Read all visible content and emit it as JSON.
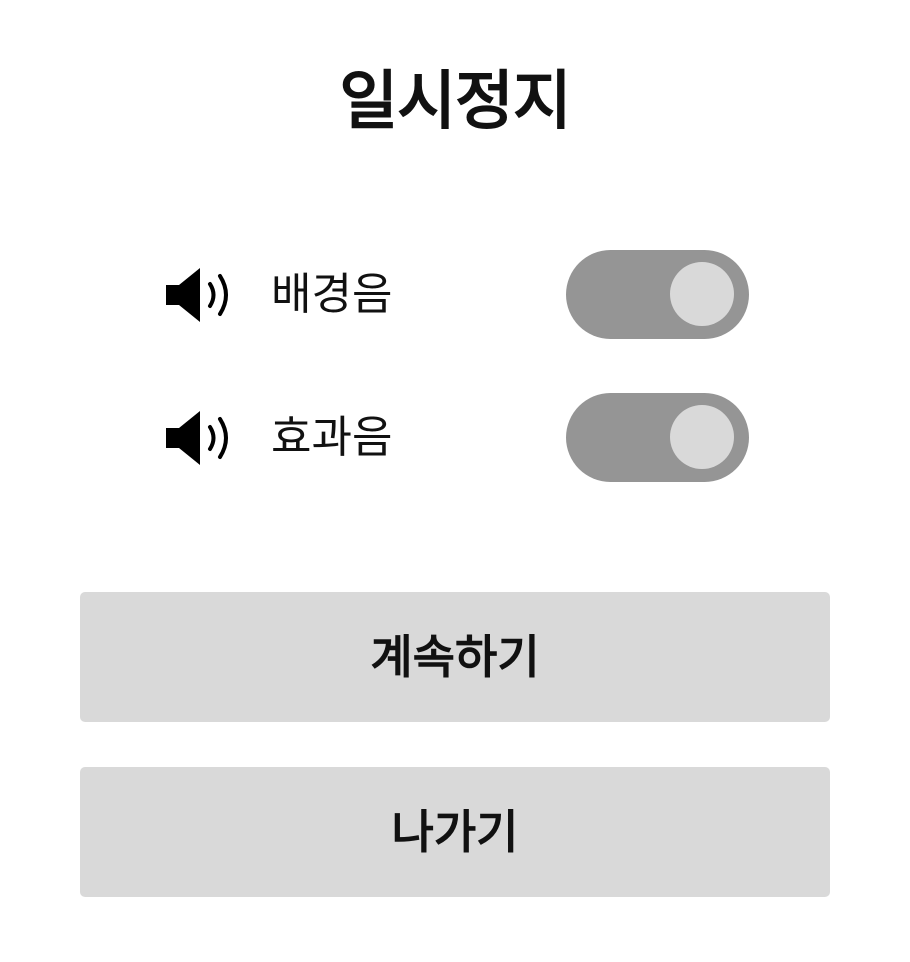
{
  "pause_menu": {
    "title": "일시정지",
    "settings": [
      {
        "label": "배경음",
        "icon": "speaker-volume-icon",
        "enabled": true
      },
      {
        "label": "효과음",
        "icon": "speaker-volume-icon",
        "enabled": true
      }
    ],
    "buttons": {
      "continue_label": "계속하기",
      "exit_label": "나가기"
    }
  },
  "colors": {
    "background": "#ffffff",
    "text": "#111111",
    "toggle_track": "#959595",
    "toggle_knob": "#d9d9d9",
    "button_background": "#d9d9d9"
  }
}
